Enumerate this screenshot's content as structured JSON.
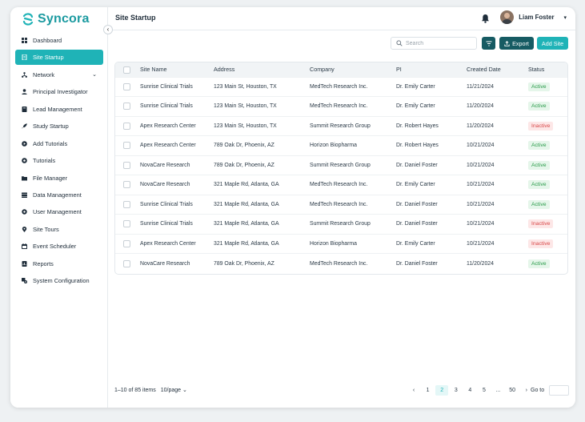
{
  "app": {
    "name": "Syncora"
  },
  "sidebar": {
    "items": [
      {
        "label": "Dashboard",
        "icon": "grid-icon"
      },
      {
        "label": "Site Startup",
        "icon": "document-icon",
        "active": true
      },
      {
        "label": "Network",
        "icon": "network-icon",
        "expandable": true
      },
      {
        "label": "Principal Investigator",
        "icon": "person-icon"
      },
      {
        "label": "Lead Management",
        "icon": "book-icon"
      },
      {
        "label": "Study Startup",
        "icon": "rocket-icon"
      },
      {
        "label": "Add Tutorials",
        "icon": "play-circle-icon"
      },
      {
        "label": "Tutorials",
        "icon": "gear-play-icon"
      },
      {
        "label": "File Manager",
        "icon": "folder-icon"
      },
      {
        "label": "Data Management",
        "icon": "database-icon"
      },
      {
        "label": "User Management",
        "icon": "settings-icon"
      },
      {
        "label": "Site Tours",
        "icon": "pin-icon"
      },
      {
        "label": "Event Scheduler",
        "icon": "calendar-icon"
      },
      {
        "label": "Reports",
        "icon": "report-icon"
      },
      {
        "label": "System Configuration",
        "icon": "system-config-icon"
      }
    ]
  },
  "header": {
    "title": "Site Startup",
    "user_name": "Liam Foster"
  },
  "toolbar": {
    "search_placeholder": "Search",
    "export_label": "Export",
    "add_label": "Add Site"
  },
  "table": {
    "columns": [
      "Site Name",
      "Address",
      "Company",
      "PI",
      "Created Date",
      "Status"
    ],
    "rows": [
      {
        "site": "Sunrise Clinical Trials",
        "address": "123 Main St, Houston, TX",
        "company": "MedTech Research Inc.",
        "pi": "Dr. Emily Carter",
        "date": "11/21/2024",
        "status": "Active"
      },
      {
        "site": "Sunrise Clinical Trials",
        "address": "123 Main St, Houston, TX",
        "company": "MedTech Research Inc.",
        "pi": "Dr. Emily Carter",
        "date": "11/20/2024",
        "status": "Active"
      },
      {
        "site": "Apex Research Center",
        "address": "123 Main St, Houston, TX",
        "company": "Summit Research Group",
        "pi": "Dr. Robert Hayes",
        "date": "11/20/2024",
        "status": "Inactive"
      },
      {
        "site": "Apex Research Center",
        "address": "789 Oak Dr, Phoenix, AZ",
        "company": "Horizon Biopharma",
        "pi": "Dr. Robert Hayes",
        "date": "10/21/2024",
        "status": "Active"
      },
      {
        "site": "NovaCare Research",
        "address": "789 Oak Dr, Phoenix, AZ",
        "company": "Summit Research Group",
        "pi": "Dr. Daniel Foster",
        "date": "10/21/2024",
        "status": "Active"
      },
      {
        "site": "NovaCare Research",
        "address": "321 Maple Rd, Atlanta, GA",
        "company": "MedTech Research Inc.",
        "pi": "Dr. Emily Carter",
        "date": "10/21/2024",
        "status": "Active"
      },
      {
        "site": "Sunrise Clinical Trials",
        "address": "321 Maple Rd, Atlanta, GA",
        "company": "MedTech Research Inc.",
        "pi": "Dr. Daniel Foster",
        "date": "10/21/2024",
        "status": "Active"
      },
      {
        "site": "Sunrise Clinical Trials",
        "address": "321 Maple Rd, Atlanta, GA",
        "company": "Summit Research Group",
        "pi": "Dr. Daniel Foster",
        "date": "10/21/2024",
        "status": "Inactive"
      },
      {
        "site": "Apex Research Center",
        "address": "321 Maple Rd, Atlanta, GA",
        "company": "Horizon Biopharma",
        "pi": "Dr. Emily Carter",
        "date": "10/21/2024",
        "status": "Inactive"
      },
      {
        "site": "NovaCare Research",
        "address": "789 Oak Dr, Phoenix, AZ",
        "company": "MedTech Research Inc.",
        "pi": "Dr. Daniel Foster",
        "date": "11/20/2024",
        "status": "Active"
      }
    ]
  },
  "footer": {
    "range_text": "1–10 of 85 items",
    "per_page": "10/page",
    "pages": [
      "1",
      "2",
      "3",
      "4",
      "5",
      "...",
      "50"
    ],
    "current_page": "2",
    "goto_label": "Go to"
  },
  "colors": {
    "brand": "#1fb3b7",
    "dark_button": "#165b63",
    "active_badge": "#2a9b4a",
    "inactive_badge": "#d8494a"
  }
}
